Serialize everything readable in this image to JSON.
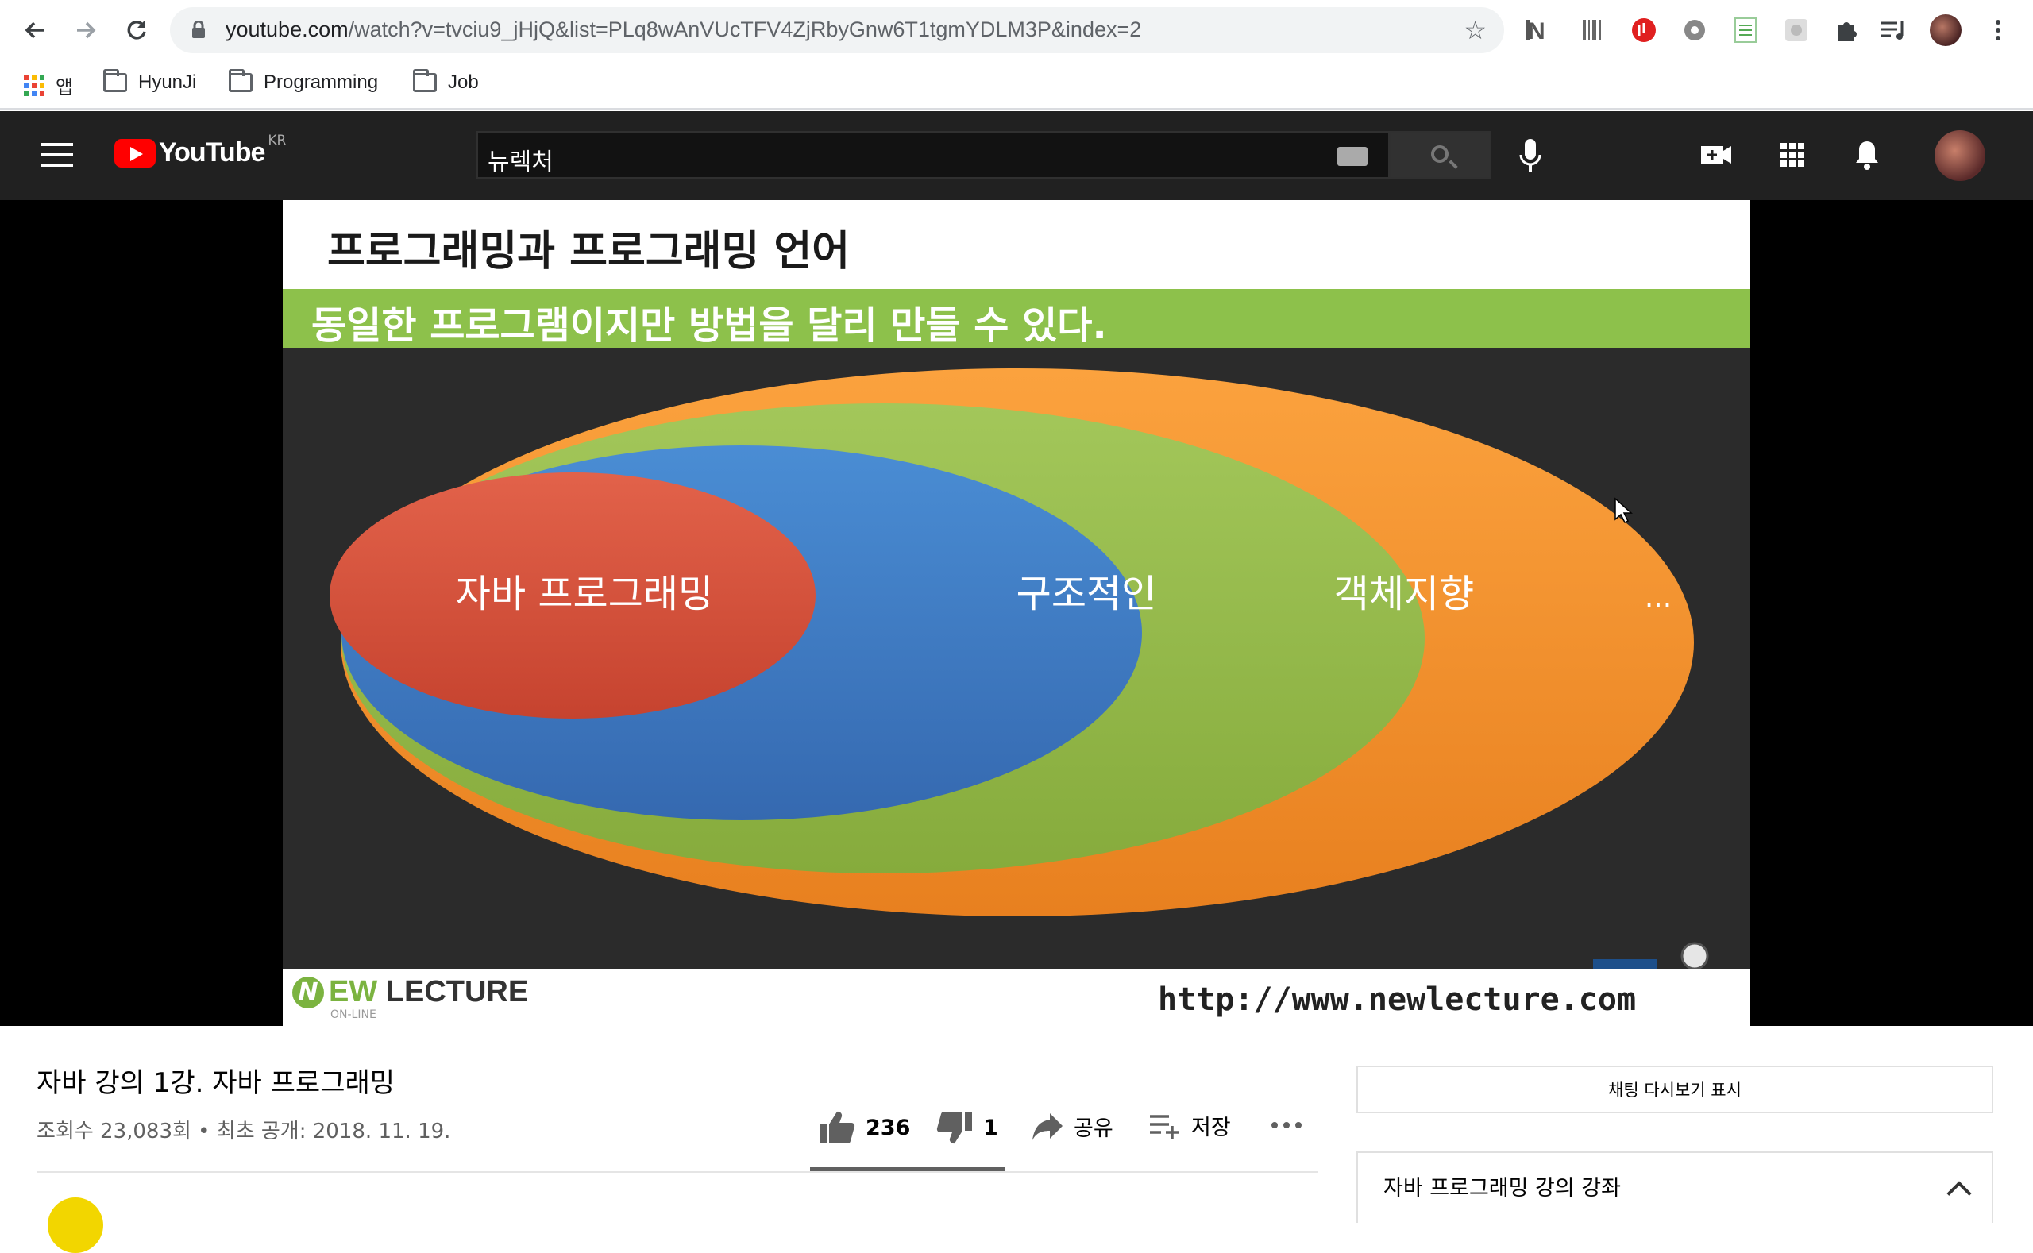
{
  "browser": {
    "url_host": "youtube.com",
    "url_path": "/watch?v=tvciu9_jHjQ&list=PLq8wAnVUcTFV4ZjRbyGnw6T1tgmYDLM3P&index=2",
    "bookmarks": [
      {
        "label": "앱",
        "icon": "apps-grid-icon"
      },
      {
        "label": "HyunJi",
        "icon": "folder-icon"
      },
      {
        "label": "Programming",
        "icon": "folder-icon"
      },
      {
        "label": "Job",
        "icon": "folder-icon"
      }
    ]
  },
  "youtube": {
    "logo_text": "YouTube",
    "region": "KR",
    "search_query": "뉴렉처"
  },
  "slide": {
    "title": "프로그래밍과 프로그래밍 언어",
    "subtitle": "동일한 프로그램이지만 방법을 달리 만들 수 있다.",
    "labels": {
      "java": "자바 프로그래밍",
      "structured": "구조적인",
      "oop": "객체지향",
      "etc": "..."
    },
    "brand_ew": "EW",
    "brand_lecture": "LECTURE",
    "brand_online": "ON-LINE",
    "url": "http://www.newlecture.com",
    "colors": {
      "orange": "#f7952e",
      "green": "#93b84a",
      "blue": "#3f7fc6",
      "red": "#d9513c",
      "band": "#8dc14b"
    }
  },
  "video": {
    "title": "자바 강의 1강. 자바 프로그래밍",
    "meta": "조회수 23,083회 • 최초 공개: 2018. 11. 19.",
    "likes": "236",
    "dislikes": "1",
    "share_label": "공유",
    "save_label": "저장",
    "like_ratio": 0.996
  },
  "sidebar": {
    "chat_replay_label": "채팅 다시보기 표시",
    "playlist_title": "자바 프로그래밍 강의 강좌"
  }
}
